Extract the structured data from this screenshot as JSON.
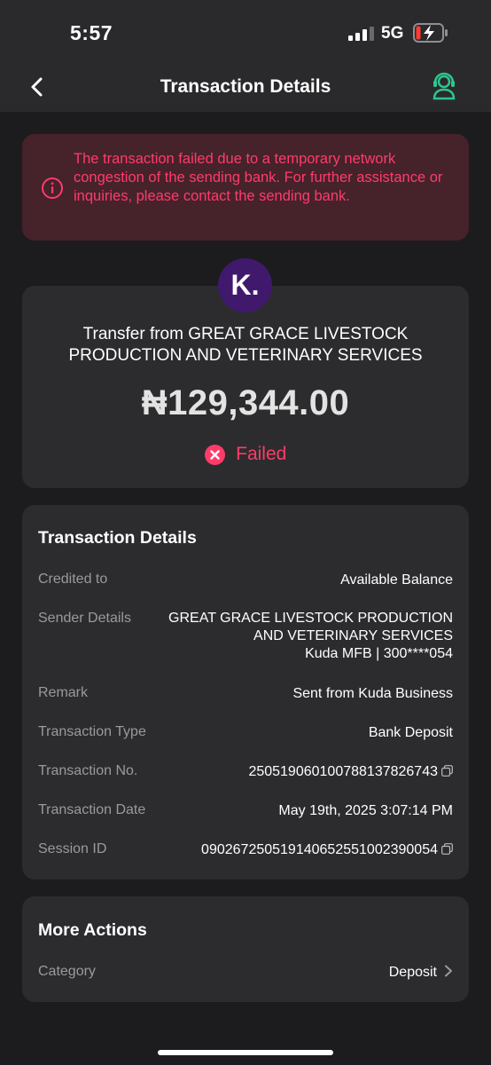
{
  "status_bar": {
    "time": "5:57",
    "network": "5G"
  },
  "nav": {
    "title": "Transaction Details"
  },
  "alert": {
    "icon": "info-circle-icon",
    "message": "The transaction failed due to a temporary network congestion of the sending bank. For further assistance or inquiries, please contact the sending bank."
  },
  "summary": {
    "logo_text": "K.",
    "title": "Transfer from GREAT GRACE LIVESTOCK PRODUCTION AND VETERINARY SERVICES",
    "amount": "₦129,344.00",
    "status": "Failed",
    "status_color": "#ff3b6a"
  },
  "details": {
    "title": "Transaction Details",
    "credited_to": {
      "label": "Credited to",
      "value": "Available Balance"
    },
    "sender": {
      "label": "Sender Details",
      "line1": "GREAT GRACE LIVESTOCK PRODUCTION",
      "line2": "AND VETERINARY SERVICES",
      "line3": "Kuda MFB | 300****054"
    },
    "remark": {
      "label": "Remark",
      "value": "Sent from Kuda Business"
    },
    "type": {
      "label": "Transaction Type",
      "value": "Bank Deposit"
    },
    "number": {
      "label": "Transaction No.",
      "value": "250519060100788137826743"
    },
    "date": {
      "label": "Transaction Date",
      "value": "May 19th, 2025 3:07:14 PM"
    },
    "session": {
      "label": "Session ID",
      "value": "090267250519140652551002390054"
    }
  },
  "actions": {
    "title": "More Actions",
    "category": {
      "label": "Category",
      "value": "Deposit"
    }
  },
  "colors": {
    "accent": "#2fc48d",
    "danger": "#ff3b6a",
    "brand": "#40196d"
  }
}
